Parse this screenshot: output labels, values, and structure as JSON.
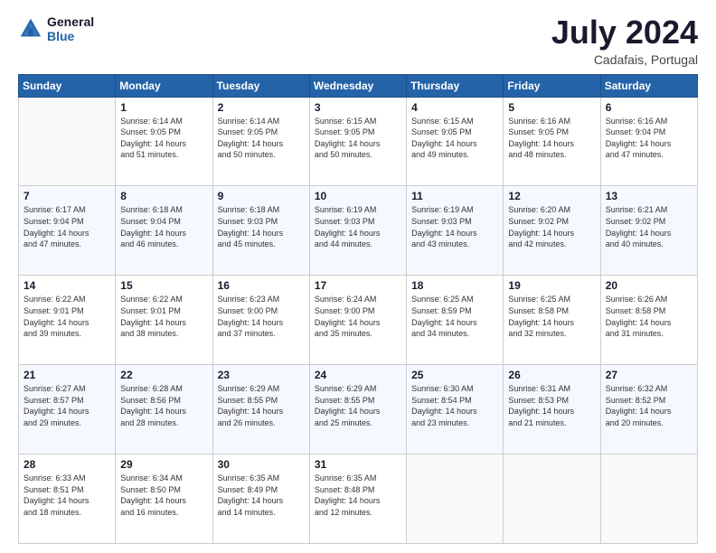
{
  "logo": {
    "line1": "General",
    "line2": "Blue"
  },
  "title": "July 2024",
  "subtitle": "Cadafais, Portugal",
  "days_of_week": [
    "Sunday",
    "Monday",
    "Tuesday",
    "Wednesday",
    "Thursday",
    "Friday",
    "Saturday"
  ],
  "weeks": [
    [
      {
        "num": "",
        "info": ""
      },
      {
        "num": "1",
        "info": "Sunrise: 6:14 AM\nSunset: 9:05 PM\nDaylight: 14 hours\nand 51 minutes."
      },
      {
        "num": "2",
        "info": "Sunrise: 6:14 AM\nSunset: 9:05 PM\nDaylight: 14 hours\nand 50 minutes."
      },
      {
        "num": "3",
        "info": "Sunrise: 6:15 AM\nSunset: 9:05 PM\nDaylight: 14 hours\nand 50 minutes."
      },
      {
        "num": "4",
        "info": "Sunrise: 6:15 AM\nSunset: 9:05 PM\nDaylight: 14 hours\nand 49 minutes."
      },
      {
        "num": "5",
        "info": "Sunrise: 6:16 AM\nSunset: 9:05 PM\nDaylight: 14 hours\nand 48 minutes."
      },
      {
        "num": "6",
        "info": "Sunrise: 6:16 AM\nSunset: 9:04 PM\nDaylight: 14 hours\nand 47 minutes."
      }
    ],
    [
      {
        "num": "7",
        "info": "Sunrise: 6:17 AM\nSunset: 9:04 PM\nDaylight: 14 hours\nand 47 minutes."
      },
      {
        "num": "8",
        "info": "Sunrise: 6:18 AM\nSunset: 9:04 PM\nDaylight: 14 hours\nand 46 minutes."
      },
      {
        "num": "9",
        "info": "Sunrise: 6:18 AM\nSunset: 9:03 PM\nDaylight: 14 hours\nand 45 minutes."
      },
      {
        "num": "10",
        "info": "Sunrise: 6:19 AM\nSunset: 9:03 PM\nDaylight: 14 hours\nand 44 minutes."
      },
      {
        "num": "11",
        "info": "Sunrise: 6:19 AM\nSunset: 9:03 PM\nDaylight: 14 hours\nand 43 minutes."
      },
      {
        "num": "12",
        "info": "Sunrise: 6:20 AM\nSunset: 9:02 PM\nDaylight: 14 hours\nand 42 minutes."
      },
      {
        "num": "13",
        "info": "Sunrise: 6:21 AM\nSunset: 9:02 PM\nDaylight: 14 hours\nand 40 minutes."
      }
    ],
    [
      {
        "num": "14",
        "info": "Sunrise: 6:22 AM\nSunset: 9:01 PM\nDaylight: 14 hours\nand 39 minutes."
      },
      {
        "num": "15",
        "info": "Sunrise: 6:22 AM\nSunset: 9:01 PM\nDaylight: 14 hours\nand 38 minutes."
      },
      {
        "num": "16",
        "info": "Sunrise: 6:23 AM\nSunset: 9:00 PM\nDaylight: 14 hours\nand 37 minutes."
      },
      {
        "num": "17",
        "info": "Sunrise: 6:24 AM\nSunset: 9:00 PM\nDaylight: 14 hours\nand 35 minutes."
      },
      {
        "num": "18",
        "info": "Sunrise: 6:25 AM\nSunset: 8:59 PM\nDaylight: 14 hours\nand 34 minutes."
      },
      {
        "num": "19",
        "info": "Sunrise: 6:25 AM\nSunset: 8:58 PM\nDaylight: 14 hours\nand 32 minutes."
      },
      {
        "num": "20",
        "info": "Sunrise: 6:26 AM\nSunset: 8:58 PM\nDaylight: 14 hours\nand 31 minutes."
      }
    ],
    [
      {
        "num": "21",
        "info": "Sunrise: 6:27 AM\nSunset: 8:57 PM\nDaylight: 14 hours\nand 29 minutes."
      },
      {
        "num": "22",
        "info": "Sunrise: 6:28 AM\nSunset: 8:56 PM\nDaylight: 14 hours\nand 28 minutes."
      },
      {
        "num": "23",
        "info": "Sunrise: 6:29 AM\nSunset: 8:55 PM\nDaylight: 14 hours\nand 26 minutes."
      },
      {
        "num": "24",
        "info": "Sunrise: 6:29 AM\nSunset: 8:55 PM\nDaylight: 14 hours\nand 25 minutes."
      },
      {
        "num": "25",
        "info": "Sunrise: 6:30 AM\nSunset: 8:54 PM\nDaylight: 14 hours\nand 23 minutes."
      },
      {
        "num": "26",
        "info": "Sunrise: 6:31 AM\nSunset: 8:53 PM\nDaylight: 14 hours\nand 21 minutes."
      },
      {
        "num": "27",
        "info": "Sunrise: 6:32 AM\nSunset: 8:52 PM\nDaylight: 14 hours\nand 20 minutes."
      }
    ],
    [
      {
        "num": "28",
        "info": "Sunrise: 6:33 AM\nSunset: 8:51 PM\nDaylight: 14 hours\nand 18 minutes."
      },
      {
        "num": "29",
        "info": "Sunrise: 6:34 AM\nSunset: 8:50 PM\nDaylight: 14 hours\nand 16 minutes."
      },
      {
        "num": "30",
        "info": "Sunrise: 6:35 AM\nSunset: 8:49 PM\nDaylight: 14 hours\nand 14 minutes."
      },
      {
        "num": "31",
        "info": "Sunrise: 6:35 AM\nSunset: 8:48 PM\nDaylight: 14 hours\nand 12 minutes."
      },
      {
        "num": "",
        "info": ""
      },
      {
        "num": "",
        "info": ""
      },
      {
        "num": "",
        "info": ""
      }
    ]
  ]
}
